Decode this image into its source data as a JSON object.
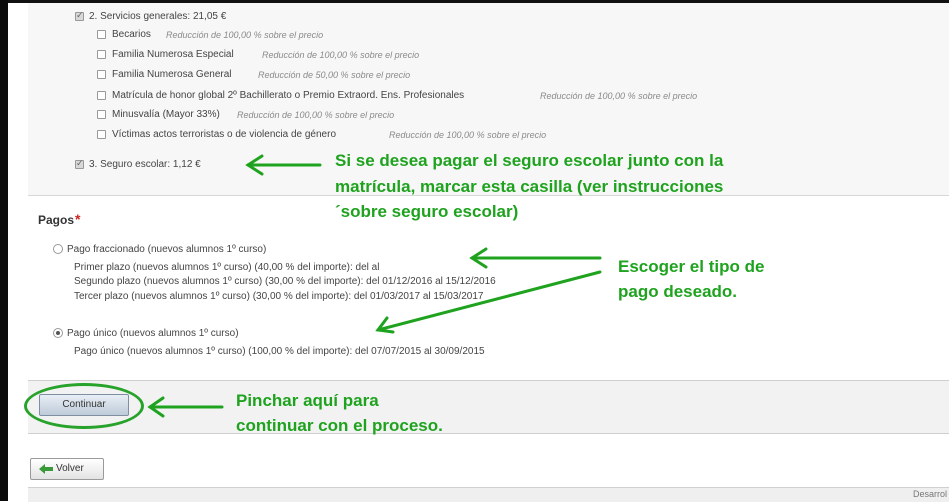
{
  "servicios": {
    "header": "2. Servicios generales: 21,05 €",
    "items": [
      {
        "label": "Becarios",
        "note": "Reducción de 100,00 % sobre el precio"
      },
      {
        "label": "Familia Numerosa Especial",
        "note": "Reducción de 100,00 % sobre el precio"
      },
      {
        "label": "Familia Numerosa General",
        "note": "Reducción de 50,00 % sobre el precio"
      },
      {
        "label": "Matrícula de honor global 2º Bachillerato o Premio Extraord. Ens. Profesionales",
        "note": "Reducción de 100,00 % sobre el precio"
      },
      {
        "label": "Minusvalía (Mayor 33%)",
        "note": "Reducción de 100,00 % sobre el precio"
      },
      {
        "label": "Víctimas actos terroristas o de violencia de género",
        "note": "Reducción de 100,00 % sobre el precio"
      }
    ],
    "seguro": "3. Seguro escolar: 1,12 €"
  },
  "pagos": {
    "title": "Pagos",
    "required_mark": "*",
    "fraccionado": {
      "label": "Pago fraccionado (nuevos alumnos 1º curso)",
      "lines": [
        "Primer plazo (nuevos alumnos 1º curso) (40,00 % del importe): del al",
        "Segundo plazo (nuevos alumnos 1º curso) (30,00 % del importe): del 01/12/2016 al 15/12/2016",
        "Tercer plazo (nuevos alumnos 1º curso) (30,00 % del importe): del 01/03/2017 al 15/03/2017"
      ]
    },
    "unico": {
      "label": "Pago único (nuevos alumnos 1º curso)",
      "line": "Pago único (nuevos alumnos 1º curso) (100,00 % del importe): del 07/07/2015 al 30/09/2015"
    }
  },
  "buttons": {
    "continuar": "Continuar",
    "volver": "Volver"
  },
  "annotations": {
    "seguro": [
      "Si se desea pagar el seguro escolar junto con la",
      "matrícula, marcar esta casilla (ver instrucciones",
      "´sobre seguro escolar)"
    ],
    "pago": [
      "Escoger el tipo de",
      "pago deseado."
    ],
    "continuar": [
      "Pinchar aquí para",
      "continuar con el proceso."
    ]
  },
  "footer": {
    "text": "Desarrol"
  },
  "colors": {
    "annotation": "#1fa31f"
  }
}
